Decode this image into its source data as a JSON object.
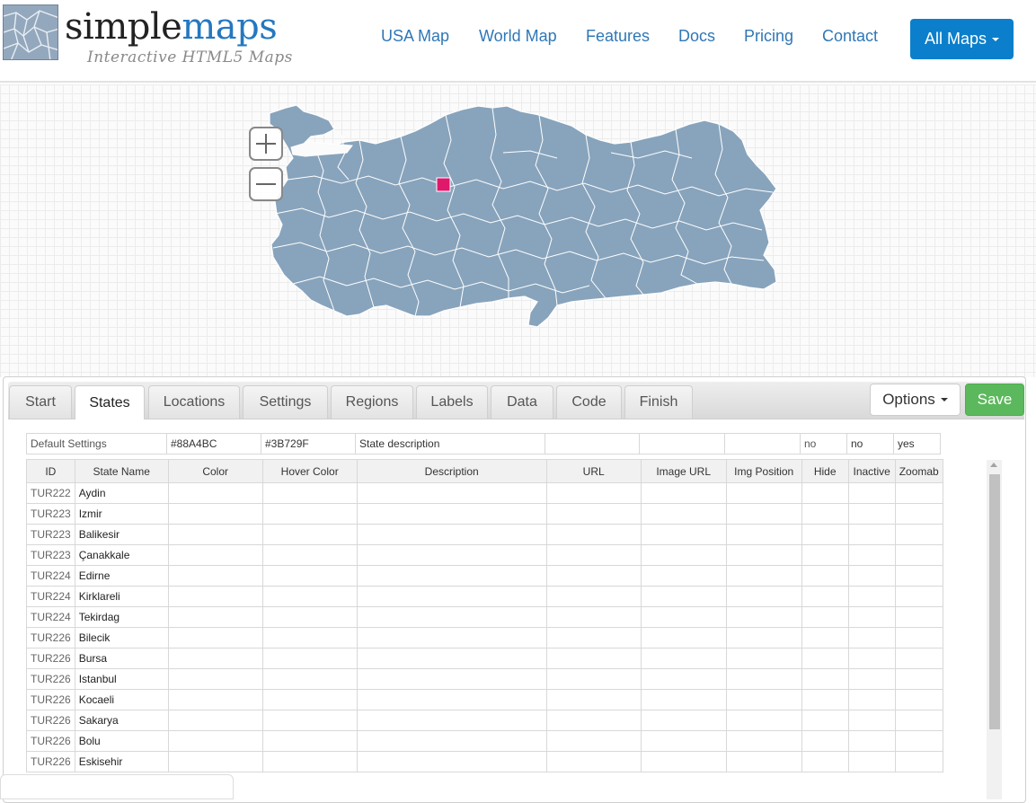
{
  "brand": {
    "name_part1": "simple",
    "name_part2": "maps",
    "tagline": "Interactive HTML5 Maps"
  },
  "nav": {
    "items": [
      {
        "label": "USA Map"
      },
      {
        "label": "World Map"
      },
      {
        "label": "Features"
      },
      {
        "label": "Docs"
      },
      {
        "label": "Pricing"
      },
      {
        "label": "Contact"
      }
    ],
    "all_maps_label": "All Maps"
  },
  "map": {
    "fill_color": "#88A4BC",
    "border_color": "#ffffff",
    "marker_color": "#E0186B",
    "zoom_in_icon": "plus-icon",
    "zoom_out_icon": "minus-icon"
  },
  "tabs": [
    {
      "label": "Start",
      "active": false
    },
    {
      "label": "States",
      "active": true
    },
    {
      "label": "Locations",
      "active": false
    },
    {
      "label": "Settings",
      "active": false
    },
    {
      "label": "Regions",
      "active": false
    },
    {
      "label": "Labels",
      "active": false
    },
    {
      "label": "Data",
      "active": false
    },
    {
      "label": "Code",
      "active": false
    },
    {
      "label": "Finish",
      "active": false
    }
  ],
  "actions": {
    "options_label": "Options",
    "save_label": "Save",
    "save_color": "#5cb85c"
  },
  "defaults": {
    "label": "Default Settings",
    "color": "#88A4BC",
    "hover_color": "#3B729F",
    "description": "State description",
    "url": "",
    "image_url": "",
    "img_position": "",
    "hide": "no",
    "inactive": "no",
    "zoomable": "yes"
  },
  "table": {
    "headers": [
      "ID",
      "State Name",
      "Color",
      "Hover Color",
      "Description",
      "URL",
      "Image URL",
      "Img Position",
      "Hide",
      "Inactive",
      "Zoomab"
    ],
    "rows": [
      {
        "id": "TUR222",
        "name": "Aydin"
      },
      {
        "id": "TUR223",
        "name": "Izmir"
      },
      {
        "id": "TUR223",
        "name": "Balikesir"
      },
      {
        "id": "TUR223",
        "name": "Çanakkale"
      },
      {
        "id": "TUR224",
        "name": "Edirne"
      },
      {
        "id": "TUR224",
        "name": "Kirklareli"
      },
      {
        "id": "TUR224",
        "name": "Tekirdag"
      },
      {
        "id": "TUR226",
        "name": "Bilecik"
      },
      {
        "id": "TUR226",
        "name": "Bursa"
      },
      {
        "id": "TUR226",
        "name": "Istanbul"
      },
      {
        "id": "TUR226",
        "name": "Kocaeli"
      },
      {
        "id": "TUR226",
        "name": "Sakarya"
      },
      {
        "id": "TUR226",
        "name": "Bolu"
      },
      {
        "id": "TUR226",
        "name": "Eskisehir"
      }
    ]
  }
}
